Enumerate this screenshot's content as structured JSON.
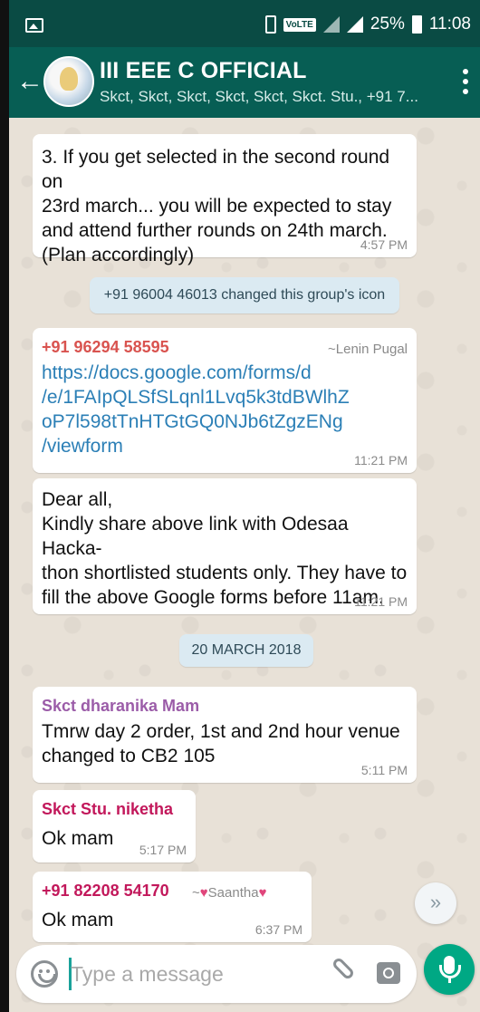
{
  "status_bar": {
    "volte": "VoLTE",
    "battery": "25%",
    "time": "11:08"
  },
  "header": {
    "title": "III EEE C OFFICIAL",
    "subtitle": "Skct, Skct, Skct, Skct, Skct, Skct. Stu., +91 7..."
  },
  "messages": {
    "m1": {
      "lines": [
        "3. If you get selected in the second round on",
        "23rd march... you will be expected to stay",
        "and attend further rounds on 24th march.",
        "(Plan accordingly)"
      ],
      "time": "4:57 PM"
    },
    "sys1": "+91 96004 46013 changed this group's icon",
    "m2": {
      "sender": "+91 96294 58595",
      "alias": "~Lenin Pugal",
      "link_lines": [
        "https://docs.google.com/forms/d",
        "/e/1FAIpQLSfSLqnl1Lvq5k3tdBWlhZ",
        "oP7l598tTnHTGtGQ0NJb6tZgzENg",
        "/viewform"
      ],
      "time": "11:21 PM"
    },
    "m3": {
      "lines": [
        "Dear all,",
        "Kindly share above link with  Odesaa Hacka-",
        "thon shortlisted students only.  They have to",
        "fill the above Google forms before 11am."
      ],
      "time": "11:21 PM"
    },
    "date_chip": "20 MARCH 2018",
    "m4": {
      "sender": "Skct dharanika Mam",
      "lines": [
        "Tmrw day 2 order, 1st and 2nd hour venue",
        "changed to CB2 105"
      ],
      "time": "5:11 PM"
    },
    "m5": {
      "sender": "Skct Stu. niketha",
      "text": "Ok mam",
      "time": "5:17 PM"
    },
    "m6": {
      "sender": "+91 82208 54170",
      "alias": "Saantha",
      "text": "Ok mam",
      "time": "6:37 PM"
    }
  },
  "composer": {
    "placeholder": "Type a message"
  },
  "colors": {
    "header": "#075e54",
    "status": "#0a4b44",
    "accent": "#00a884",
    "sender_red": "#d9534f",
    "sender_purple": "#9b5ca8",
    "sender_pink": "#c2185b"
  },
  "icons": [
    "back-arrow-icon",
    "group-avatar-icon",
    "overflow-menu-icon",
    "emoji-icon",
    "attach-icon",
    "camera-icon",
    "mic-icon",
    "chevron-down-icon"
  ]
}
